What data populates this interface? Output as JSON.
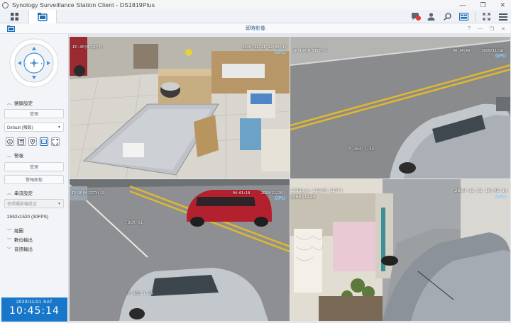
{
  "window": {
    "title": "Synology Surveillance Station Client - DS1819Plus",
    "controls": [
      "—",
      "❐",
      "✕"
    ]
  },
  "toolbar": {
    "main_menu_icon": "grid-icon",
    "live_view_icon": "live-view-icon",
    "right_icons": [
      "notification-icon",
      "user-icon",
      "search-icon",
      "layout-icon",
      "fullscreen-icon",
      "menu-icon"
    ]
  },
  "panel_window": {
    "title": "即時影像",
    "controls": [
      "?",
      "—",
      "❐",
      "✕"
    ]
  },
  "left_panel": {
    "ptz_label": "",
    "sections": {
      "lens": "鏡頭設定",
      "alarm": "警報",
      "stream": "串流設定",
      "zoom": "縮圖",
      "digital_output": "數位輸出",
      "audio_output": "音訊輸出"
    },
    "lens_manage_button": "管理",
    "preset_select": "Default (預設)",
    "alarm_manage_button": "管理",
    "alarm_panel_button": "警報面板",
    "stream_select": "依照攝影機設定",
    "resolution": "2592x1520 (30FPS)",
    "clock": {
      "date": "2020/11/21 SAT",
      "time": "10:45:14"
    }
  },
  "cameras": [
    {
      "name": "IP-4P(M-CITY)",
      "timestamp": "2020-11-21 12:35:17",
      "gpu": "GPU",
      "selected": true
    },
    {
      "name": "IP-10P(M-CITY)-1",
      "timestamp": "00:34:49",
      "timestamp2": "2020/11/18",
      "gpu": "GPU",
      "watermark": "P-263 T-34",
      "selected": false
    },
    {
      "name": "IP-3E(M-CITY)-2",
      "timestamp": "04:01:18",
      "timestamp2": "2020/11/20",
      "gpu": "GPU",
      "watermark": "P-163 T-29",
      "road_text": "TOUR 01",
      "selected": false
    },
    {
      "name": "I335poe-216(M-CITY)",
      "resolution": "2560X1440",
      "timestamp": "2020-11-21 10:45:14",
      "gpu": "GPU",
      "selected": false
    }
  ],
  "colors": {
    "accent": "#1877c9",
    "selected_border": "#e2b33a",
    "gpu_text": "#7fd0ff"
  }
}
